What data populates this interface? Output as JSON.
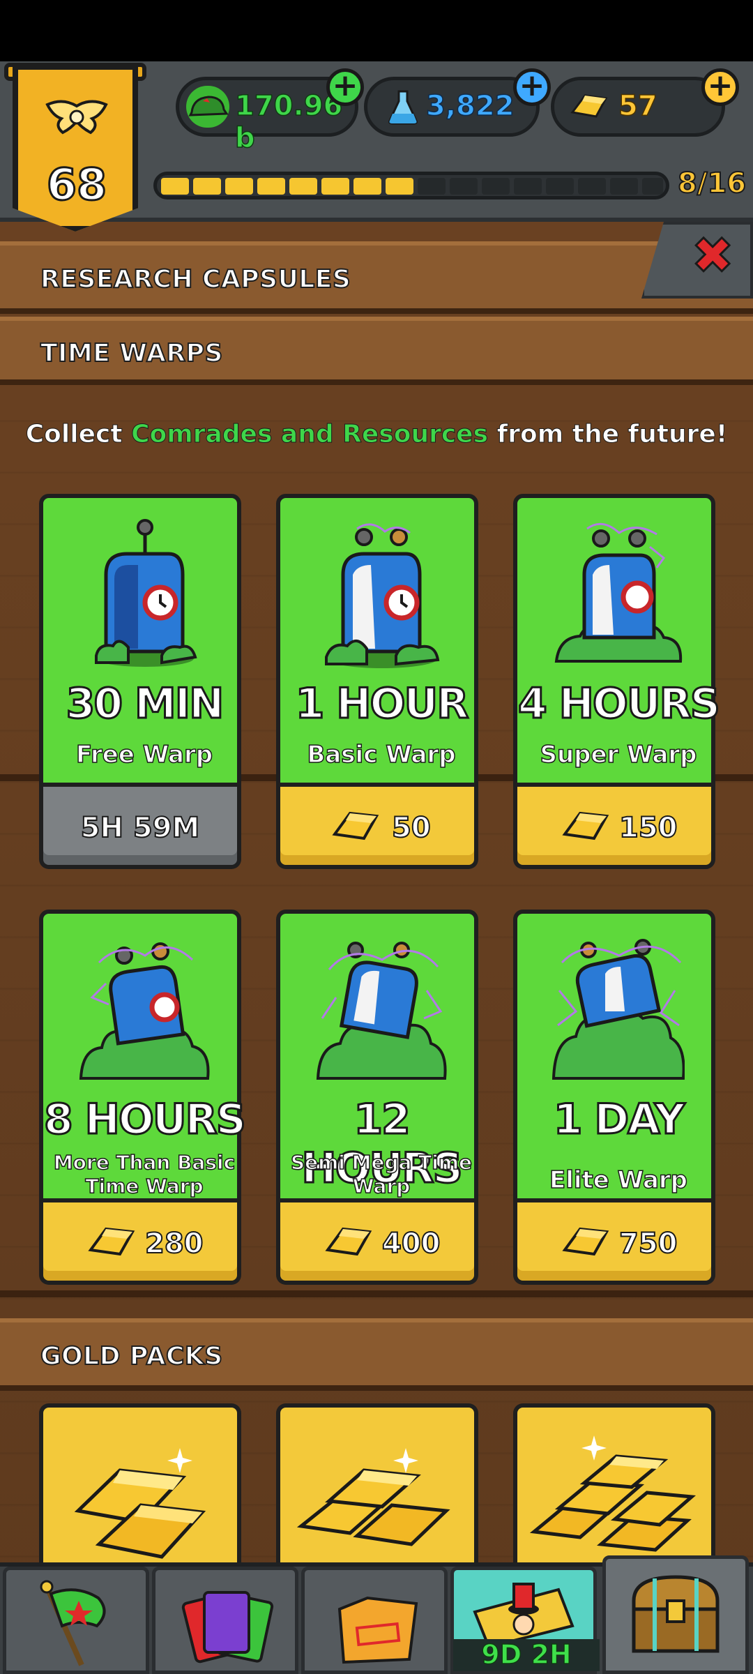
{
  "hud": {
    "rank": "68",
    "currencies": {
      "cash": "170.96 b",
      "science": "3,822",
      "gold": "57"
    },
    "progress_label": "8/16",
    "progress_fraction": 0.5
  },
  "sections": {
    "research_capsules": "RESEARCH CAPSULES",
    "time_warps": "TIME WARPS",
    "gold_packs": "GOLD PACKS"
  },
  "subtitle": {
    "before": "Collect ",
    "highlight": "Comrades and Resources",
    "after": " from the future!"
  },
  "warps": [
    {
      "duration": "30 MIN",
      "name": "Free Warp",
      "price": "5H 59M"
    },
    {
      "duration": "1 HOUR",
      "name": "Basic Warp",
      "price": "50"
    },
    {
      "duration": "4 HOURS",
      "name": "Super Warp",
      "price": "150"
    },
    {
      "duration": "8 HOURS",
      "name": "More Than Basic Time Warp",
      "price": "280"
    },
    {
      "duration": "12 HOURS",
      "name": "Semi Mega Time Warp",
      "price": "400"
    },
    {
      "duration": "1 DAY",
      "name": "Elite Warp",
      "price": "750"
    }
  ],
  "nav": {
    "event_timer": "9D 2H"
  },
  "colors": {
    "card_green": "#5ed93b",
    "price_gold": "#f3c93a",
    "highlight_green": "#3fd64a",
    "close_red": "#e0282b"
  }
}
